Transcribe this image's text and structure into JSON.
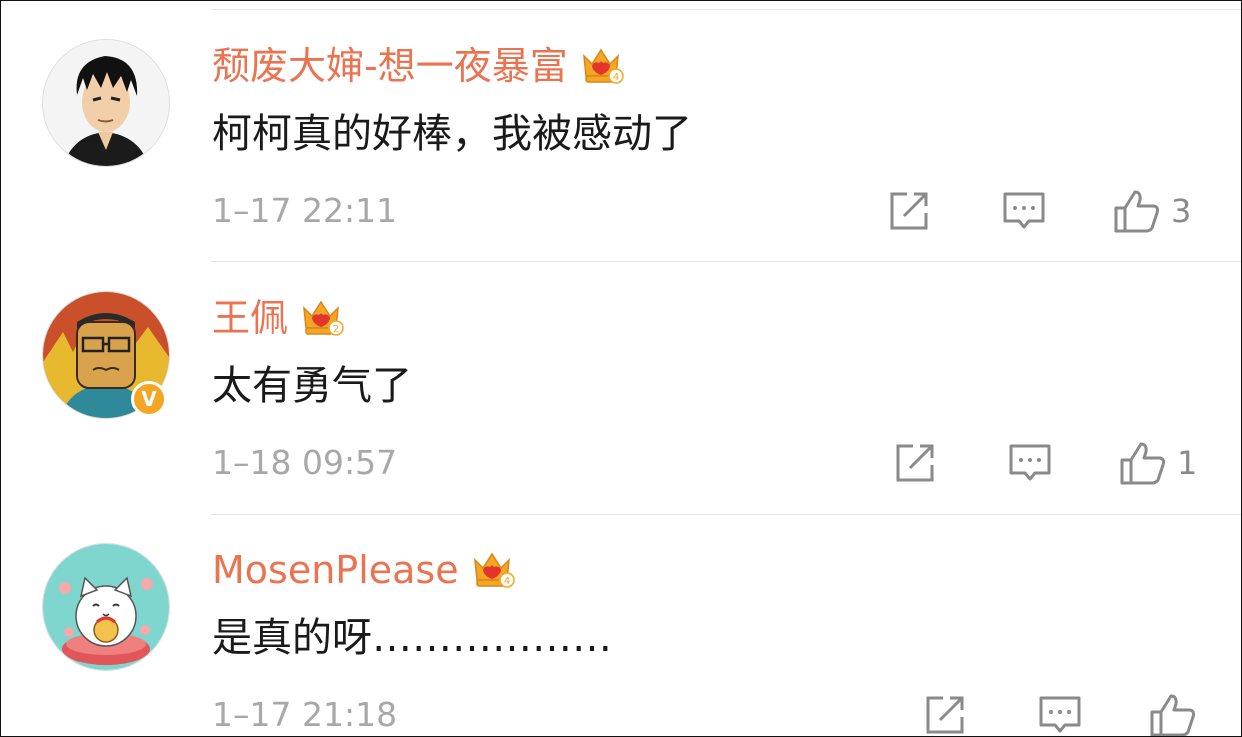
{
  "comments": [
    {
      "username": "颓废大婶-想一夜暴富",
      "crown_level": "4",
      "text": "柯柯真的好棒，我被感动了",
      "time": "1–17 22:11",
      "likes": "3",
      "verified": false,
      "avatar": "cartoon-man-avatar"
    },
    {
      "username": "王佩",
      "crown_level": "2",
      "text": "太有勇气了",
      "time": "1–18 09:57",
      "likes": "1",
      "verified": true,
      "verified_glyph": "V",
      "avatar": "glasses-man-avatar"
    },
    {
      "username": "MosenPlease",
      "crown_level": "4",
      "text": "是真的呀………………",
      "time": "1–17 21:18",
      "likes": "",
      "verified": false,
      "avatar": "lucky-cat-avatar"
    }
  ],
  "colors": {
    "username": "#eb7350",
    "text": "#1a1a1a",
    "meta": "#a8a8a8",
    "icon": "#8a8a8a",
    "verified_badge": "#f4a623",
    "crown": "#f5a623"
  },
  "icons": {
    "share": "share-icon",
    "reply": "comment-icon",
    "like": "thumbs-up-icon"
  }
}
